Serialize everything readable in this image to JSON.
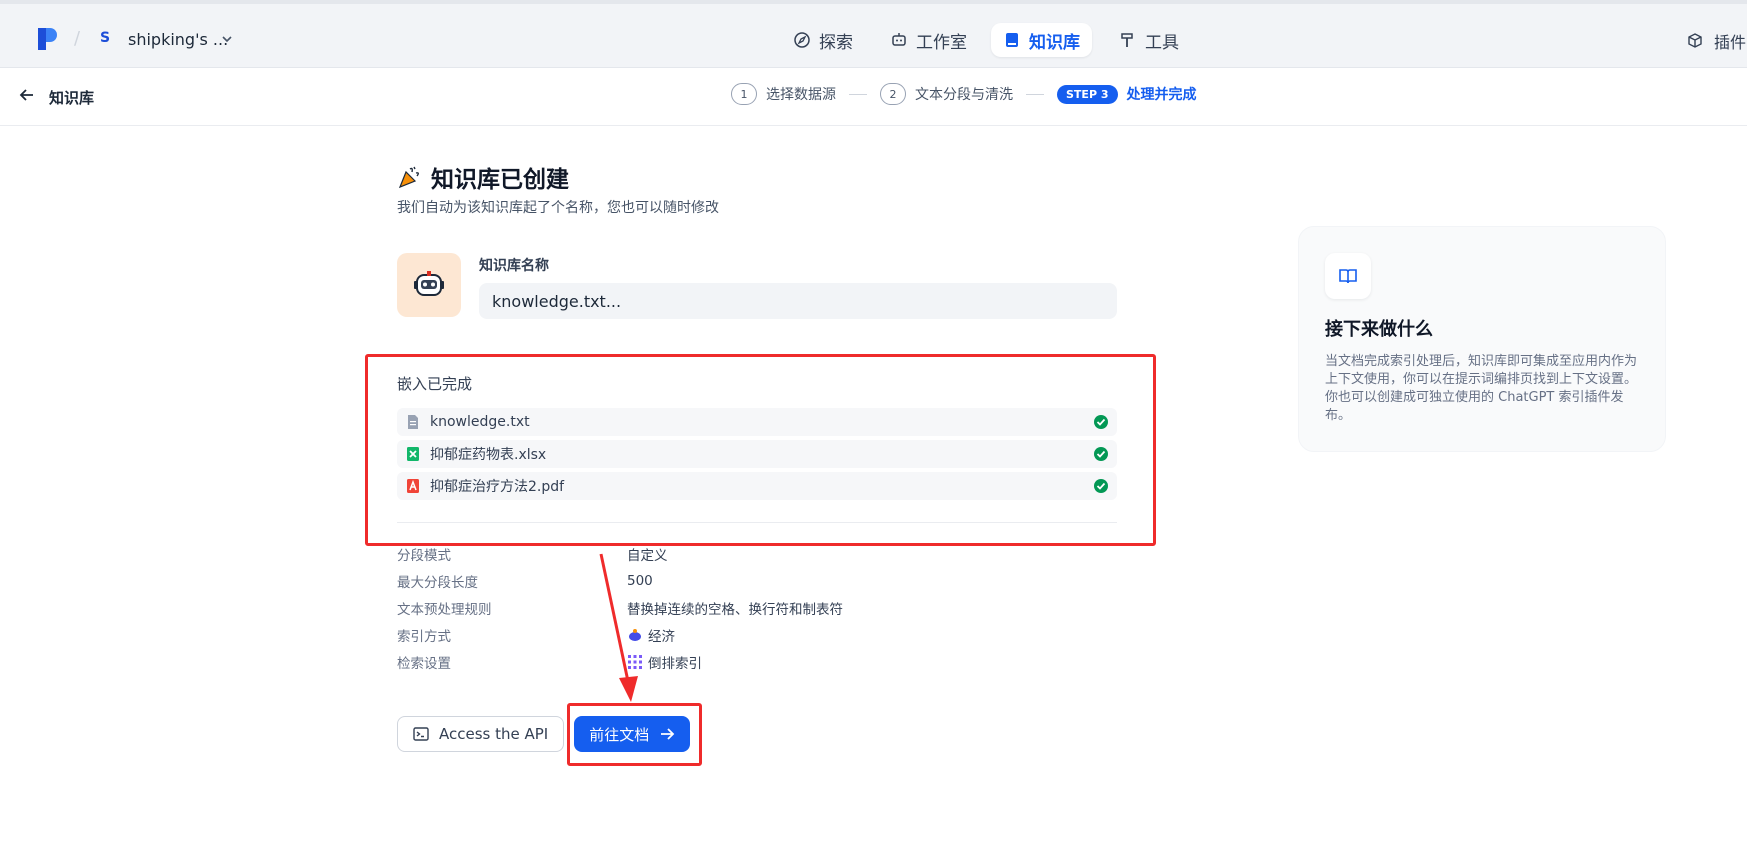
{
  "topbar": {
    "workspace_initial": "S",
    "workspace_name": "shipking's ...",
    "tabs": [
      {
        "label": "探索",
        "icon": "compass-icon"
      },
      {
        "label": "工作室",
        "icon": "robot-icon"
      },
      {
        "label": "知识库",
        "icon": "book-icon",
        "active": true
      },
      {
        "label": "工具",
        "icon": "hammer-icon"
      }
    ],
    "plugins_label": "插件"
  },
  "subheader": {
    "title": "知识库",
    "steps": [
      {
        "num": "1",
        "label": "选择数据源"
      },
      {
        "num": "2",
        "label": "文本分段与清洗"
      },
      {
        "num": "STEP 3",
        "label": "处理并完成",
        "active": true
      }
    ]
  },
  "main": {
    "title": "知识库已创建",
    "desc": "我们自动为该知识库起了个名称，您也可以随时修改",
    "name_label": "知识库名称",
    "name_value": "knowledge.txt...",
    "embed_title": "嵌入已完成",
    "files": [
      {
        "name": "knowledge.txt",
        "type": "txt"
      },
      {
        "name": "抑郁症药物表.xlsx",
        "type": "xlsx"
      },
      {
        "name": "抑郁症治疗方法2.pdf",
        "type": "pdf"
      }
    ],
    "props": [
      {
        "key": "分段模式",
        "value": "自定义"
      },
      {
        "key": "最大分段长度",
        "value": "500"
      },
      {
        "key": "文本预处理规则",
        "value": "替换掉连续的空格、换行符和制表符"
      },
      {
        "key": "索引方式",
        "value": "经济"
      },
      {
        "key": "检索设置",
        "value": "倒排索引"
      }
    ],
    "api_button": "Access the API",
    "doc_button": "前往文档"
  },
  "panel": {
    "title": "接下来做什么",
    "text": "当文档完成索引处理后，知识库即可集成至应用内作为上下文使用，你可以在提示词编排页找到上下文设置。你也可以创建成可独立使用的 ChatGPT 索引插件发布。"
  },
  "colors": {
    "accent": "#155eef",
    "annotation": "#ef2b2b",
    "success": "#039855"
  }
}
